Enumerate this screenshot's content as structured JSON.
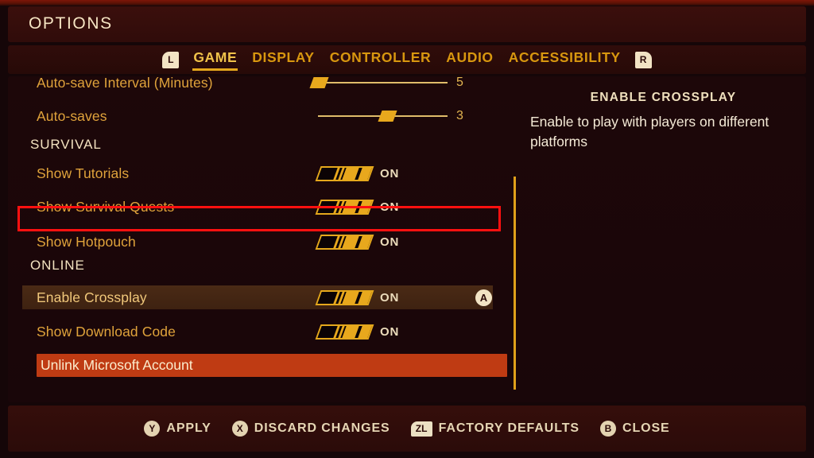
{
  "header": {
    "title": "OPTIONS"
  },
  "tabs": {
    "prev_shoulder": "L",
    "next_shoulder": "R",
    "items": [
      {
        "label": "GAME",
        "active": true
      },
      {
        "label": "DISPLAY",
        "active": false
      },
      {
        "label": "CONTROLLER",
        "active": false
      },
      {
        "label": "AUDIO",
        "active": false
      },
      {
        "label": "ACCESSIBILITY",
        "active": false
      }
    ]
  },
  "settings": {
    "rows": [
      {
        "type": "slider",
        "label": "Auto-save Interval (Minutes)",
        "value": "5",
        "fill_percent": 2
      },
      {
        "type": "slider",
        "label": "Auto-saves",
        "value": "3",
        "fill_percent": 52
      },
      {
        "type": "section",
        "label": "SURVIVAL"
      },
      {
        "type": "toggle",
        "label": "Show Tutorials",
        "state": "ON"
      },
      {
        "type": "toggle",
        "label": "Show Survival Quests",
        "state": "ON"
      },
      {
        "type": "toggle",
        "label": "Show Hotpouch",
        "state": "ON"
      },
      {
        "type": "section",
        "label": "ONLINE"
      },
      {
        "type": "toggle",
        "label": "Enable Crossplay",
        "state": "ON",
        "selected": true,
        "button_hint": "A"
      },
      {
        "type": "toggle",
        "label": "Show Download Code",
        "state": "ON"
      },
      {
        "type": "button",
        "label": "Unlink Microsoft Account"
      }
    ]
  },
  "description": {
    "title": "ENABLE CROSSPLAY",
    "body": "Enable to play with players on different platforms"
  },
  "footer": {
    "actions": [
      {
        "button": "Y",
        "shape": "circle",
        "label": "APPLY"
      },
      {
        "button": "X",
        "shape": "circle",
        "label": "DISCARD CHANGES"
      },
      {
        "button": "ZL",
        "shape": "rect",
        "label": "FACTORY DEFAULTS"
      },
      {
        "button": "B",
        "shape": "circle",
        "label": "CLOSE"
      }
    ]
  },
  "colors": {
    "accent_gold": "#e8a81d",
    "label_gold": "#e0a33b",
    "cream": "#f3e2c0",
    "annotation_red": "#ff1010",
    "danger_button": "#bf3b13"
  }
}
